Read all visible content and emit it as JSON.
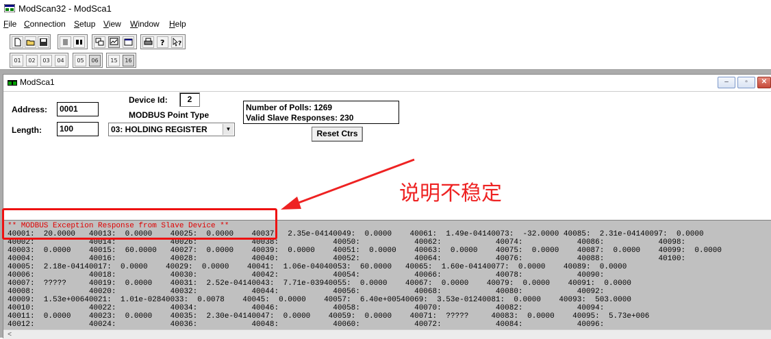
{
  "app": {
    "title": "ModScan32 - ModSca1"
  },
  "menu": {
    "items": [
      {
        "label": "File",
        "mnemonic": "F",
        "rest": "ile"
      },
      {
        "label": "Connection",
        "mnemonic": "C",
        "rest": "onnection"
      },
      {
        "label": "Setup",
        "mnemonic": "S",
        "rest": "etup"
      },
      {
        "label": "View",
        "mnemonic": "V",
        "rest": "iew"
      },
      {
        "label": "Window",
        "mnemonic": "W",
        "rest": "indow"
      },
      {
        "label": "Help",
        "mnemonic": "H",
        "rest": "elp"
      }
    ]
  },
  "toolbar1": {
    "buttons": [
      "new-file-icon",
      "open-folder-icon",
      "save-icon",
      "connect-icon",
      "disconnect-icon",
      "display-options-icon",
      "graph-icon",
      "window-icon",
      "print-icon",
      "help-icon",
      "context-help-icon"
    ]
  },
  "toolbar2": {
    "buttons": [
      {
        "icon": "coil-01-icon",
        "text": "01"
      },
      {
        "icon": "input-status-02-icon",
        "text": "02"
      },
      {
        "icon": "input-register-03-icon",
        "text": "03"
      },
      {
        "icon": "holding-register-04-icon",
        "text": "04"
      },
      {
        "icon": "write-coil-05-icon",
        "text": "05"
      },
      {
        "icon": "write-register-06-icon",
        "text": "06"
      },
      {
        "icon": "write-coils-15-icon",
        "text": "15"
      },
      {
        "icon": "write-registers-16-icon",
        "text": "16"
      }
    ]
  },
  "child_window": {
    "title": "ModSca1",
    "controls": {
      "minimize": "–",
      "maximize": "▫",
      "close": "✕"
    }
  },
  "form": {
    "address_label": "Address:",
    "address_value": "0001",
    "length_label": "Length:",
    "length_value": "100",
    "device_id_label": "Device Id:",
    "device_id_value": "2",
    "point_type_label": "MODBUS Point Type",
    "point_type_value": "03: HOLDING REGISTER",
    "polls_label": "Number of Polls: 1269",
    "valid_label": "Valid Slave Responses: 230",
    "reset_button": "Reset Ctrs"
  },
  "data": {
    "exception": "** MODBUS Exception Response from Slave Device **",
    "rows": [
      "40001:  20.0000   40013:  0.0000    40025:  0.0000    40037:  2.35e-04140049:  0.0000    40061:  1.49e-04140073:  -32.0000 40085:  2.31e-04140097:  0.0000",
      "40002:            40014:            40026:            40038:            40050:            40062:            40074:            40086:            40098:",
      "40003:  0.0000    40015:  60.0000   40027:  0.0000    40039:  0.0000    40051:  0.0000    40063:  0.0000    40075:  0.0000    40087:  0.0000    40099:  0.0000",
      "40004:            40016:            40028:            40040:            40052:            40064:            40076:            40088:            40100:",
      "40005:  2.18e-04140017:  0.0000    40029:  0.0000    40041:  1.06e-04040053:  60.0000   40065:  1.60e-04140077:  0.0000    40089:  0.0000",
      "40006:            40018:            40030:            40042:            40054:            40066:            40078:            40090:",
      "40007:  ?????     40019:  0.0000    40031:  2.52e-04140043:  7.71e-03940055:  0.0000    40067:  0.0000    40079:  0.0000    40091:  0.0000",
      "40008:            40020:            40032:            40044:            40056:            40068:            40080:            40092:",
      "40009:  1.53e+00640021:  1.01e-02840033:  0.0078    40045:  0.0000    40057:  6.40e+00540069:  3.53e-01240081:  0.0000    40093:  503.0000",
      "40010:            40022:            40034:            40046:            40058:            40070:            40082:            40094:",
      "40011:  0.0000    40023:  0.0000    40035:  2.30e-04140047:  0.0000    40059:  0.0000    40071:  ?????     40083:  0.0000    40095:  5.73e+006",
      "40012:            40024:            40036:            40048:            40060:            40072:            40084:            40096:"
    ]
  },
  "annotation": {
    "text": "说明不稳定",
    "color": "#ee2222"
  }
}
